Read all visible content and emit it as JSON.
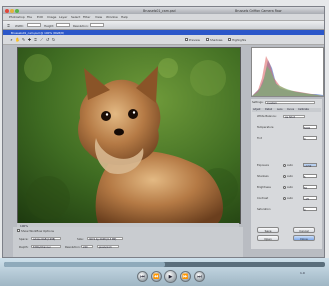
{
  "titlebar": {
    "app_title": "Adobe Photoshop",
    "document_title": "Brussels01_cam.psd",
    "panel_title": "Brussels Griffon Camera Raw"
  },
  "menu": [
    "Photoshop",
    "File",
    "Edit",
    "Image",
    "Layer",
    "Select",
    "Filter",
    "View",
    "Window",
    "Help"
  ],
  "options": {
    "width_label": "Width:",
    "height_label": "Height:",
    "resolution_label": "Resolution:"
  },
  "tab": {
    "label": "Brussels01_cam.psd @ 100% (RGB/8)"
  },
  "tools": [
    "zoom",
    "hand",
    "white-balance",
    "color-sampler",
    "crop",
    "straighten",
    "rotate-left",
    "rotate-right"
  ],
  "toggles": {
    "preview": "Preview",
    "shadows": "Shadows",
    "highlights": "Highlights"
  },
  "zoom": "100%",
  "right_panel": {
    "settings_label": "Settings:",
    "settings_value": "Custom",
    "tabs": [
      "Adjust",
      "Detail",
      "Lens",
      "Curve",
      "Calibrate"
    ],
    "white_balance_label": "White Balance:",
    "white_balance_value": "As Shot",
    "rows": [
      {
        "label": "Temperature",
        "value": "5000"
      },
      {
        "label": "Tint",
        "value": "0"
      },
      {
        "label": "Exposure",
        "value": "+0.50",
        "auto": "Auto"
      },
      {
        "label": "Shadows",
        "value": "5",
        "auto": "Auto"
      },
      {
        "label": "Brightness",
        "value": "50",
        "auto": "Auto"
      },
      {
        "label": "Contrast",
        "value": "+25",
        "auto": "Auto"
      },
      {
        "label": "Saturation",
        "value": "0"
      }
    ],
    "buttons": {
      "save": "Save",
      "cancel": "Cancel",
      "open": "Open",
      "done": "Done"
    }
  },
  "workflow": {
    "toggle_label": "Show Workflow Options",
    "space_label": "Space:",
    "space_value": "Adobe RGB (1998)",
    "size_label": "Size:",
    "size_value": "3072 by 2048 (6.3 MP)",
    "depth_label": "Depth:",
    "depth_value": "8 Bits/Channel",
    "resolution_label": "Resolution:",
    "resolution_value": "240",
    "resolution_unit": "pixels/inch"
  },
  "player": {
    "progress": 0.5,
    "version": "1.0"
  }
}
